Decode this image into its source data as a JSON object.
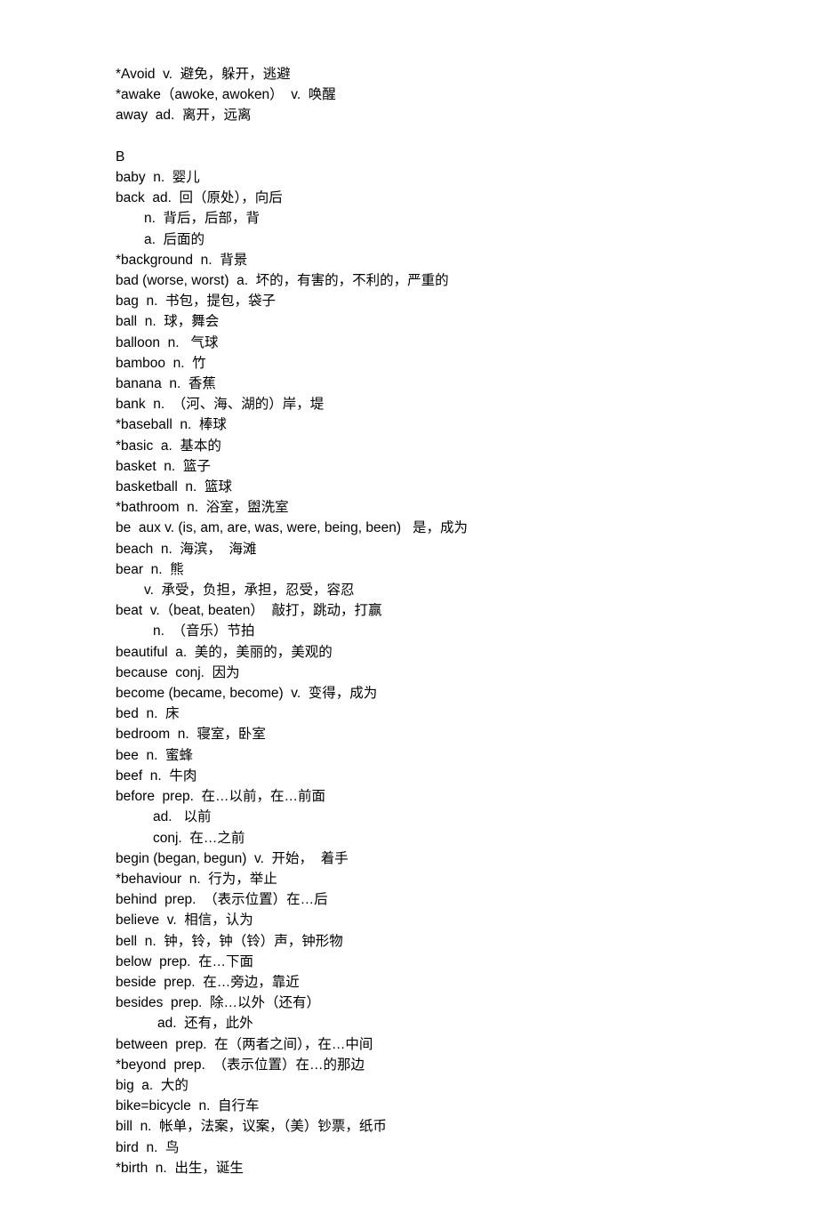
{
  "lines": [
    {
      "text": "*Avoid  v.  避免，躲开，逃避",
      "indent": 0
    },
    {
      "text": "*awake（awoke, awoken）  v.  唤醒",
      "indent": 0
    },
    {
      "text": "away  ad.  离开，远离",
      "indent": 0
    },
    {
      "text": "",
      "indent": 0
    },
    {
      "text": "B",
      "indent": 0
    },
    {
      "text": "baby  n.  婴儿",
      "indent": 0
    },
    {
      "text": "back  ad.  回（原处），向后",
      "indent": 0
    },
    {
      "text": "n.  背后，后部，背",
      "indent": 1
    },
    {
      "text": "a.  后面的",
      "indent": 1
    },
    {
      "text": "*background  n.  背景",
      "indent": 0
    },
    {
      "text": "bad (worse, worst)  a.  坏的，有害的，不利的，严重的",
      "indent": 0
    },
    {
      "text": "bag  n.  书包，提包，袋子",
      "indent": 0
    },
    {
      "text": "ball  n.  球，舞会",
      "indent": 0
    },
    {
      "text": "balloon  n.   气球",
      "indent": 0
    },
    {
      "text": "bamboo  n.  竹",
      "indent": 0
    },
    {
      "text": "banana  n.  香蕉",
      "indent": 0
    },
    {
      "text": "bank  n.  （河、海、湖的）岸，堤",
      "indent": 0
    },
    {
      "text": "*baseball  n.  棒球",
      "indent": 0
    },
    {
      "text": "*basic  a.  基本的",
      "indent": 0
    },
    {
      "text": "basket  n.  篮子",
      "indent": 0
    },
    {
      "text": "basketball  n.  篮球",
      "indent": 0
    },
    {
      "text": "*bathroom  n.  浴室，盥洗室",
      "indent": 0
    },
    {
      "text": "be  aux v. (is, am, are, was, were, being, been)   是，成为",
      "indent": 0
    },
    {
      "text": "beach  n.  海滨，  海滩",
      "indent": 0
    },
    {
      "text": "bear  n.  熊",
      "indent": 0
    },
    {
      "text": "v.  承受，负担，承担，忍受，容忍",
      "indent": 1
    },
    {
      "text": "beat  v.（beat, beaten）  敲打，跳动，打赢",
      "indent": 0
    },
    {
      "text": "n.  （音乐）节拍",
      "indent": 2
    },
    {
      "text": "beautiful  a.  美的，美丽的，美观的",
      "indent": 0
    },
    {
      "text": "because  conj.  因为",
      "indent": 0
    },
    {
      "text": "become (became, become)  v.  变得，成为",
      "indent": 0
    },
    {
      "text": "bed  n.  床",
      "indent": 0
    },
    {
      "text": "bedroom  n.  寝室，卧室",
      "indent": 0
    },
    {
      "text": "bee  n.  蜜蜂",
      "indent": 0
    },
    {
      "text": "beef  n.  牛肉",
      "indent": 0
    },
    {
      "text": "before  prep.  在…以前，在…前面",
      "indent": 0
    },
    {
      "text": "ad.   以前",
      "indent": 2
    },
    {
      "text": "conj.  在…之前",
      "indent": 2
    },
    {
      "text": "begin (began, begun)  v.  开始，  着手",
      "indent": 0
    },
    {
      "text": "*behaviour  n.  行为，举止",
      "indent": 0
    },
    {
      "text": "behind  prep.  （表示位置）在…后",
      "indent": 0
    },
    {
      "text": "believe  v.  相信，认为",
      "indent": 0
    },
    {
      "text": "bell  n.  钟，铃，钟（铃）声，钟形物",
      "indent": 0
    },
    {
      "text": "below  prep.  在…下面",
      "indent": 0
    },
    {
      "text": "beside  prep.  在…旁边，靠近",
      "indent": 0
    },
    {
      "text": "besides  prep.  除…以外（还有）",
      "indent": 0
    },
    {
      "text": "ad.  还有，此外",
      "indent": 3
    },
    {
      "text": "between  prep.  在（两者之间），在…中间",
      "indent": 0
    },
    {
      "text": "*beyond  prep.  （表示位置）在…的那边",
      "indent": 0
    },
    {
      "text": "big  a.  大的",
      "indent": 0
    },
    {
      "text": "bike=bicycle  n.  自行车",
      "indent": 0
    },
    {
      "text": "bill  n.  帐单，法案，议案，（美）钞票，纸币",
      "indent": 0
    },
    {
      "text": "bird  n.  鸟",
      "indent": 0
    },
    {
      "text": "*birth  n.  出生，诞生",
      "indent": 0
    }
  ]
}
